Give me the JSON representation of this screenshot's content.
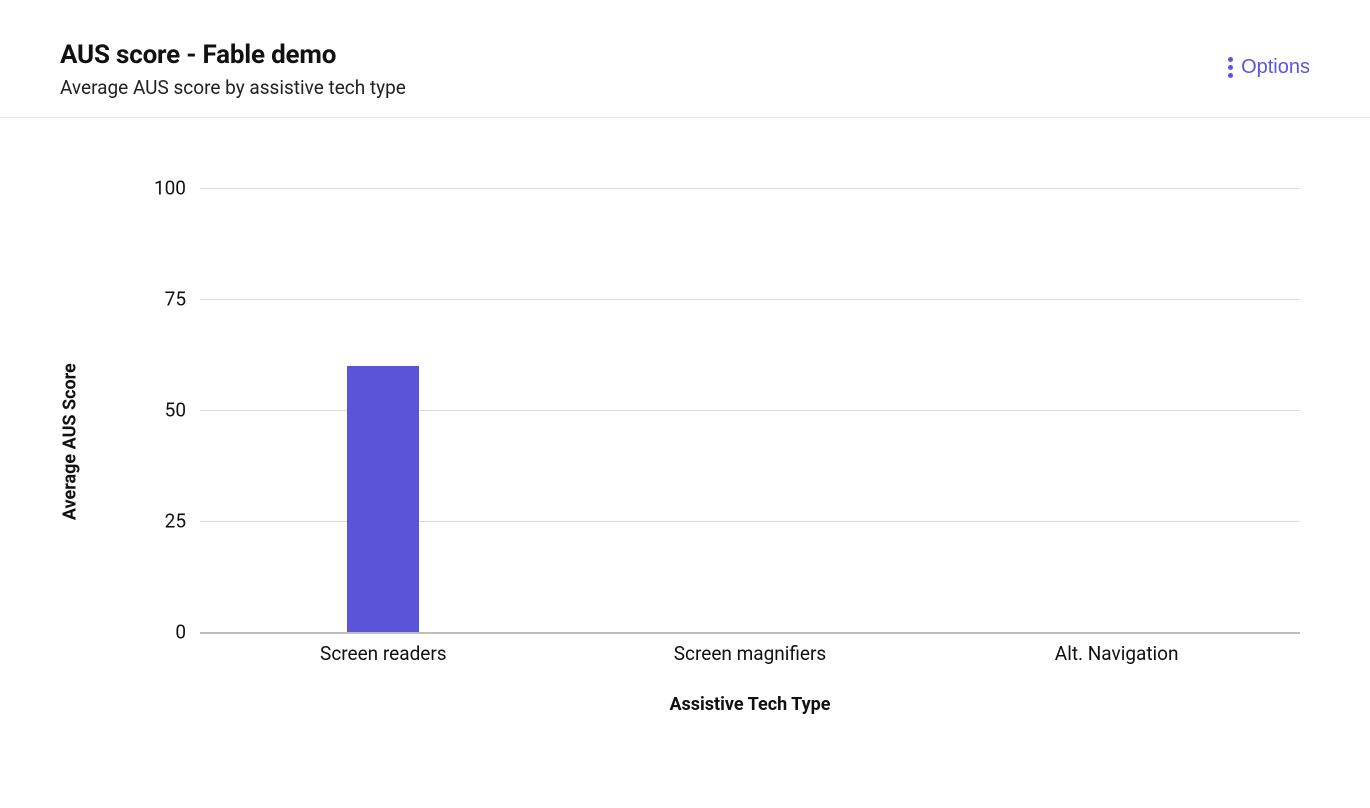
{
  "header": {
    "title": "AUS score - Fable demo",
    "subtitle": "Average AUS score by assistive tech type",
    "options_label": "Options"
  },
  "colors": {
    "accent": "#5a55e0",
    "bar_fill": "#5a55d8",
    "grid": "#dcdcdc"
  },
  "chart_data": {
    "type": "bar",
    "title": "AUS score - Fable demo",
    "categories": [
      "Screen readers",
      "Screen magnifiers",
      "Alt. Navigation"
    ],
    "values": [
      60,
      0,
      0
    ],
    "xlabel": "Assistive Tech Type",
    "ylabel": "Average AUS Score",
    "ylim": [
      0,
      100
    ],
    "yticks": [
      0,
      25,
      50,
      75,
      100
    ]
  }
}
